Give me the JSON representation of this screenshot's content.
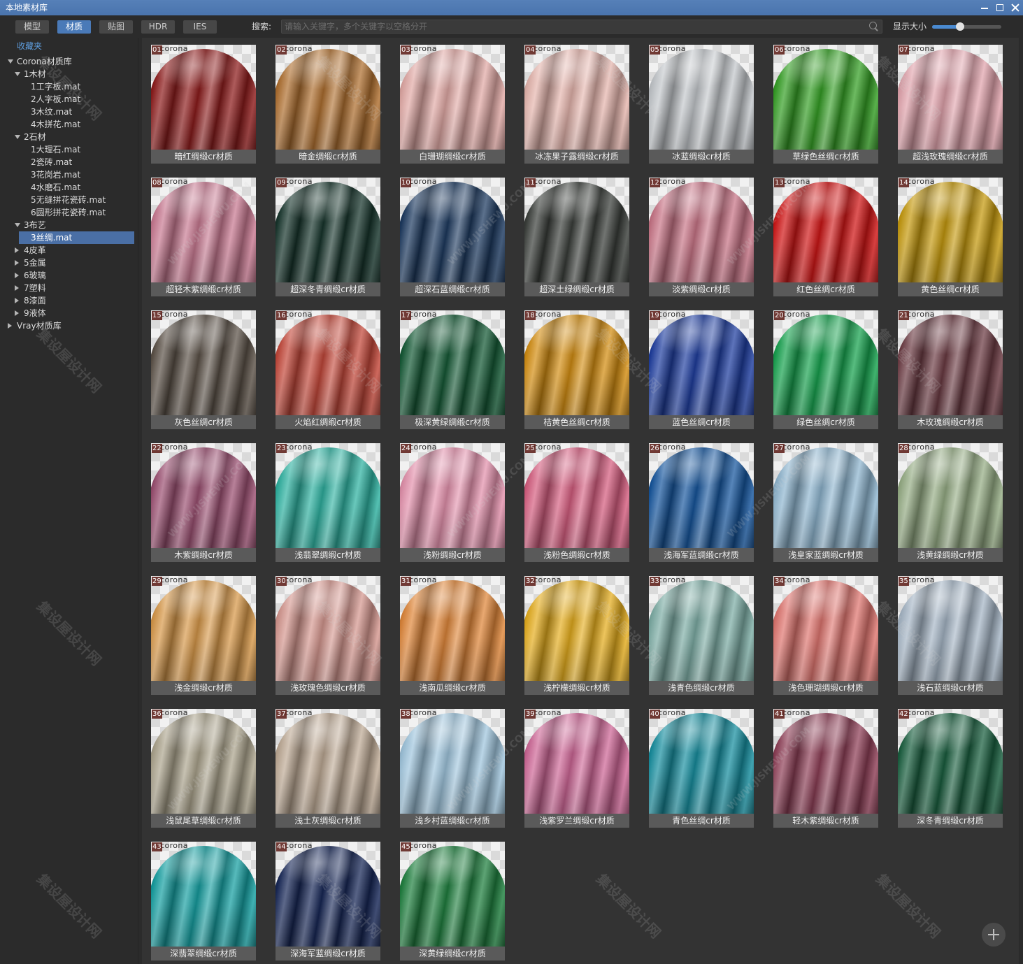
{
  "window": {
    "title": "本地素材库"
  },
  "colors": {
    "titlebar": "#4a74ad",
    "accent": "#4a7ab8",
    "selection": "#4a6fa5",
    "link": "#5f9fe0"
  },
  "toolbar": {
    "tabs": [
      {
        "label": "模型",
        "active": false
      },
      {
        "label": "材质",
        "active": true
      },
      {
        "label": "贴图",
        "active": false
      },
      {
        "label": "HDR",
        "active": false
      },
      {
        "label": "IES",
        "active": false
      }
    ],
    "search_label": "搜索:",
    "search_placeholder": "请输入关键字，多个关键字以空格分开",
    "search_value": "",
    "size_label": "显示大小",
    "size_value": 0.4
  },
  "sidebar": {
    "favorites_label": "收藏夹",
    "tree": [
      {
        "label": "Corona材质库",
        "expanded": true,
        "children": [
          {
            "label": "1木材",
            "expanded": true,
            "children": [
              {
                "label": "1工字板.mat"
              },
              {
                "label": "2人字板.mat"
              },
              {
                "label": "3木纹.mat"
              },
              {
                "label": "4木拼花.mat"
              }
            ]
          },
          {
            "label": "2石材",
            "expanded": true,
            "children": [
              {
                "label": "1大理石.mat"
              },
              {
                "label": "2瓷砖.mat"
              },
              {
                "label": "3花岗岩.mat"
              },
              {
                "label": "4水磨石.mat"
              },
              {
                "label": "5无缝拼花瓷砖.mat"
              },
              {
                "label": "6圆形拼花瓷砖.mat"
              }
            ]
          },
          {
            "label": "3布艺",
            "expanded": true,
            "children": [
              {
                "label": "3丝绸.mat",
                "selected": true
              }
            ]
          },
          {
            "label": "4皮革",
            "expanded": false,
            "has_children": true
          },
          {
            "label": "5金属",
            "expanded": false,
            "has_children": true
          },
          {
            "label": "6玻璃",
            "expanded": false,
            "has_children": true
          },
          {
            "label": "7塑料",
            "expanded": false,
            "has_children": true
          },
          {
            "label": "8漆面",
            "expanded": false,
            "has_children": true
          },
          {
            "label": "9液体",
            "expanded": false,
            "has_children": true
          }
        ]
      },
      {
        "label": "Vray材质库",
        "expanded": false,
        "has_children": true
      }
    ]
  },
  "grid": {
    "thumb_logo": "corona",
    "items": [
      {
        "num": "01",
        "label": "暗红绸缎cr材质",
        "color": "#8e1c1c"
      },
      {
        "num": "02",
        "label": "暗金绸缎cr材质",
        "color": "#b07030"
      },
      {
        "num": "03",
        "label": "白珊瑚绸缎cr材质",
        "color": "#e2aaa6"
      },
      {
        "num": "04",
        "label": "冰冻果子露绸缎cr材质",
        "color": "#e6b6ae"
      },
      {
        "num": "05",
        "label": "冰蓝绸缎cr材质",
        "color": "#c4c8cc"
      },
      {
        "num": "06",
        "label": "草绿色丝绸cr材质",
        "color": "#35a025"
      },
      {
        "num": "07",
        "label": "超浅玫瑰绸缎cr材质",
        "color": "#e2a4ad"
      },
      {
        "num": "08",
        "label": "超轻木紫绸缎cr材质",
        "color": "#c97a92"
      },
      {
        "num": "09",
        "label": "超深冬青绸缎cr材质",
        "color": "#17352c"
      },
      {
        "num": "10",
        "label": "超深石蓝绸缎cr材质",
        "color": "#1d3a60"
      },
      {
        "num": "11",
        "label": "超深土绿绸缎cr材质",
        "color": "#3b3f3b"
      },
      {
        "num": "12",
        "label": "淡紫绸缎cr材质",
        "color": "#c97587"
      },
      {
        "num": "13",
        "label": "红色丝绸cr材质",
        "color": "#d11616"
      },
      {
        "num": "14",
        "label": "黄色丝绸cr材质",
        "color": "#c69a0e"
      },
      {
        "num": "15",
        "label": "灰色丝绸cr材质",
        "color": "#5c5248"
      },
      {
        "num": "16",
        "label": "火焰红绸缎cr材质",
        "color": "#c4483a"
      },
      {
        "num": "17",
        "label": "极深黄绿绸缎cr材质",
        "color": "#155a36"
      },
      {
        "num": "18",
        "label": "桔黄色丝绸cr材质",
        "color": "#d48e12"
      },
      {
        "num": "19",
        "label": "蓝色丝绸cr材质",
        "color": "#1f3ea0"
      },
      {
        "num": "20",
        "label": "绿色丝绸cr材质",
        "color": "#17a34f"
      },
      {
        "num": "21",
        "label": "木玫瑰绸缎cr材质",
        "color": "#6c3b43"
      },
      {
        "num": "22",
        "label": "木紫绸缎cr材质",
        "color": "#9c5072"
      },
      {
        "num": "23",
        "label": "浅翡翠绸缎cr材质",
        "color": "#2fb3a2"
      },
      {
        "num": "24",
        "label": "浅粉绸缎cr材质",
        "color": "#e492ad"
      },
      {
        "num": "25",
        "label": "浅粉色绸缎cr材质",
        "color": "#d65e80"
      },
      {
        "num": "26",
        "label": "浅海军蓝绸缎cr材质",
        "color": "#16569e"
      },
      {
        "num": "27",
        "label": "浅皇家蓝绸缎cr材质",
        "color": "#8fb6d0"
      },
      {
        "num": "28",
        "label": "浅黄绿绸缎cr材质",
        "color": "#97ae86"
      },
      {
        "num": "29",
        "label": "浅金绸缎cr材质",
        "color": "#d8994a"
      },
      {
        "num": "30",
        "label": "浅玫瑰色绸缎cr材质",
        "color": "#d69890"
      },
      {
        "num": "31",
        "label": "浅南瓜绸缎cr材质",
        "color": "#e0873a"
      },
      {
        "num": "32",
        "label": "浅柠檬绸缎cr材质",
        "color": "#e6ae1e"
      },
      {
        "num": "33",
        "label": "浅青色绸缎cr材质",
        "color": "#7eaea6"
      },
      {
        "num": "34",
        "label": "浅色珊瑚绸缎cr材质",
        "color": "#e07670"
      },
      {
        "num": "35",
        "label": "浅石蓝绸缎cr材质",
        "color": "#a6b6c6"
      },
      {
        "num": "36",
        "label": "浅鼠尾草绸缎cr材质",
        "color": "#ada58e"
      },
      {
        "num": "37",
        "label": "浅土灰绸缎cr材质",
        "color": "#bfab96"
      },
      {
        "num": "38",
        "label": "浅乡村蓝绸缎cr材质",
        "color": "#a0c6de"
      },
      {
        "num": "39",
        "label": "浅紫罗兰绸缎cr材质",
        "color": "#cf6797"
      },
      {
        "num": "40",
        "label": "青色丝绸cr材质",
        "color": "#178fa0"
      },
      {
        "num": "41",
        "label": "轻木紫绸缎cr材质",
        "color": "#8f3f57"
      },
      {
        "num": "42",
        "label": "深冬青绸缎cr材质",
        "color": "#195f3f"
      },
      {
        "num": "43",
        "label": "深翡翠绸缎cr材质",
        "color": "#16a0a2"
      },
      {
        "num": "44",
        "label": "深海军蓝绸缎cr材质",
        "color": "#172757"
      },
      {
        "num": "45",
        "label": "深黄绿绸缎cr材质",
        "color": "#1f803f"
      }
    ]
  },
  "watermark": {
    "cn": "集设屋设计网",
    "en": "WWW.JISHEWU.COM"
  }
}
